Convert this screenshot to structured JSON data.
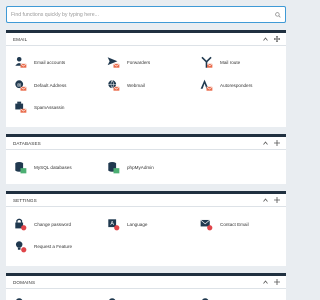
{
  "search": {
    "placeholder": "Find functions quickly by typing here..."
  },
  "sections": {
    "email": {
      "title": "EMAIL",
      "items": [
        "Email accounts",
        "Forwarders",
        "Mail route",
        "Default Address",
        "Webmail",
        "Autoresponders",
        "SpamAssassin"
      ]
    },
    "databases": {
      "title": "DATABASES",
      "items": [
        "MySQL databases",
        "phpMyAdmin"
      ]
    },
    "settings": {
      "title": "SETTINGS",
      "items": [
        "Change password",
        "Language",
        "Contact Email",
        "Request a Feature"
      ]
    },
    "domains": {
      "title": "DOMAINS"
    }
  },
  "icons": {
    "primary": "#20394f",
    "accent": "#e96c4c",
    "muted": "#2a3d50"
  }
}
